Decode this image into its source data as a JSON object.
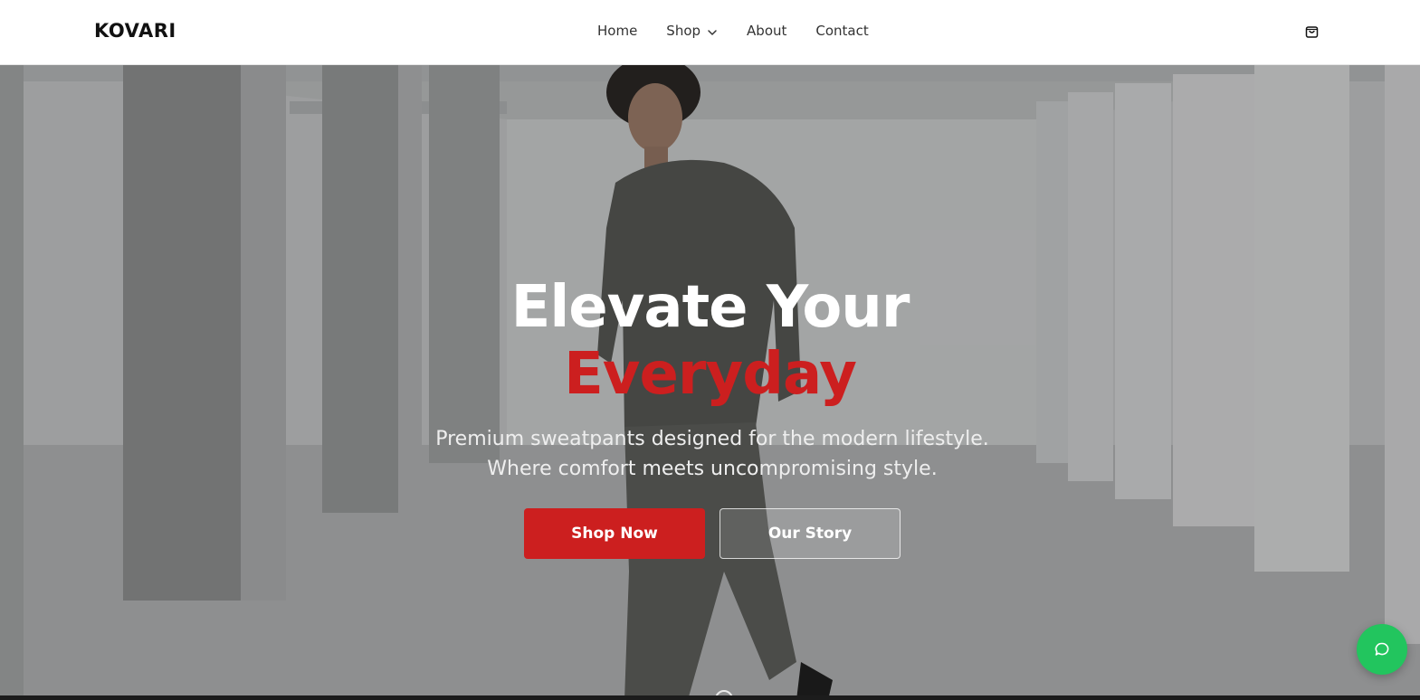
{
  "brand": {
    "logo_text": "KOVARI"
  },
  "nav": {
    "items": [
      {
        "label": "Home"
      },
      {
        "label": "Shop",
        "has_dropdown": true
      },
      {
        "label": "About"
      },
      {
        "label": "Contact"
      }
    ]
  },
  "icons": {
    "cart": "shopping-bag-icon",
    "chat": "chat-bubble-icon",
    "dropdown": "chevron-down-icon"
  },
  "hero": {
    "title_line1": "Elevate Your",
    "title_line2": "Everyday",
    "subtitle": "Premium sweatpants designed for the modern lifestyle. Where comfort meets uncompromising style.",
    "primary_button": "Shop Now",
    "secondary_button": "Our Story"
  },
  "colors": {
    "accent": "#cc1f1f",
    "chat": "#22c55e",
    "header_bg": "#ffffff",
    "hero_text": "#ffffff"
  }
}
